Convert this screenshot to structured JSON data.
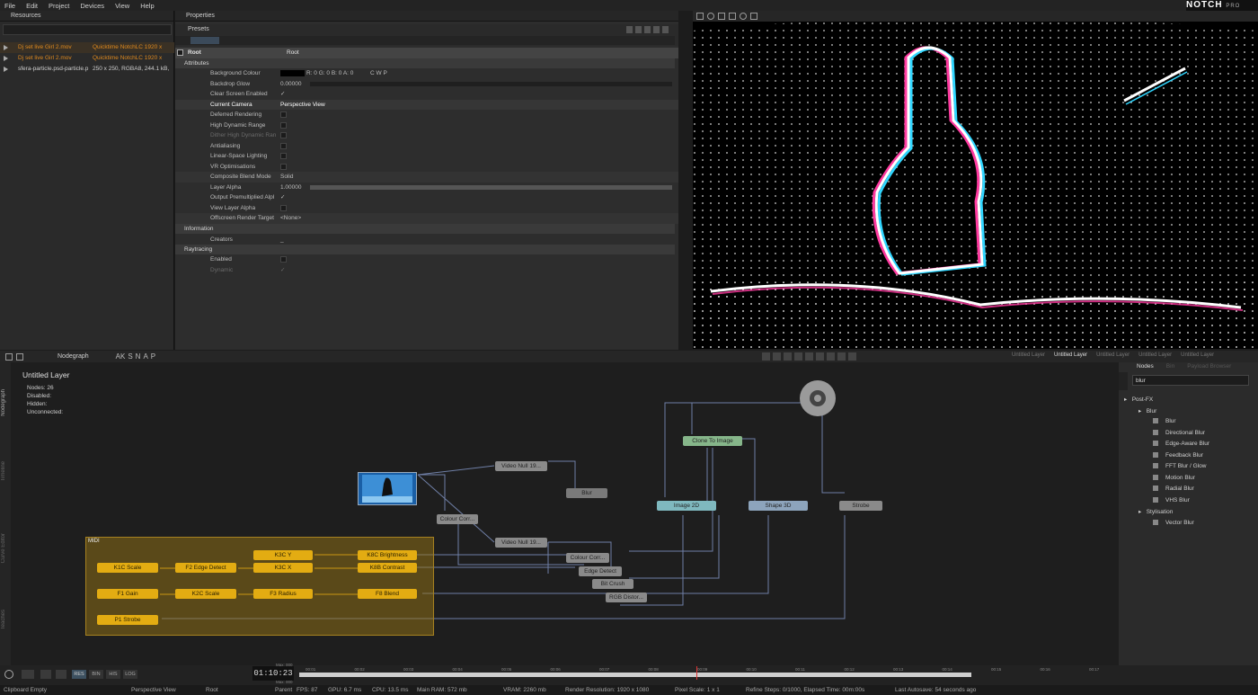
{
  "menu": [
    "File",
    "Edit",
    "Project",
    "Devices",
    "View",
    "Help"
  ],
  "brand": {
    "logo": "NOTCH",
    "edition": "PRO"
  },
  "resources": {
    "title": "Resources",
    "items": [
      {
        "name": "Dj set live Girl 2.mov",
        "format": "Quicktime NotchLC 1920 x",
        "highlight": true
      },
      {
        "name": "Dj set live Girl 2.mov",
        "format": "Quicktime NotchLC 1920 x",
        "highlight": true
      },
      {
        "name": "sfera-particle.psd-particle.p",
        "format": "250 x 250, RGBA8, 244.1 kB,",
        "highlight": false
      }
    ]
  },
  "properties": {
    "title": "Properties",
    "presets_label": "Presets",
    "root": {
      "label": "Root",
      "value": "Root"
    },
    "sections": {
      "attributes": "Attributes",
      "information": "Information",
      "raytracing": "Raytracing"
    },
    "rows": [
      {
        "label": "Background Colour",
        "value": "R: 0 G: 0 B: 0 A: 0",
        "extra": "C   W   P"
      },
      {
        "label": "Backdrop Glow",
        "value": "0.00000"
      },
      {
        "label": "Clear Screen Enabled",
        "value": "✓"
      },
      {
        "label": "Current Camera",
        "value": "Perspective View"
      },
      {
        "label": "Deferred Rendering",
        "value": ""
      },
      {
        "label": "High Dynamic Range",
        "value": ""
      },
      {
        "label": "Dither High Dynamic Ran",
        "value": "",
        "dim": true
      },
      {
        "label": "Antialiasing",
        "value": ""
      },
      {
        "label": "Linear-Space Lighting",
        "value": ""
      },
      {
        "label": "VR Optimisations",
        "value": ""
      },
      {
        "label": "Composite Blend Mode",
        "value": "Solid"
      },
      {
        "label": "Layer Alpha",
        "value": "1.00000"
      },
      {
        "label": "Output Premultiplied Alpl",
        "value": "✓"
      },
      {
        "label": "View Layer Alpha",
        "value": ""
      },
      {
        "label": "Offscreen Render Target",
        "value": "<None>"
      }
    ],
    "info_rows": [
      {
        "label": "Creators",
        "value": "_"
      }
    ],
    "ray_rows": [
      {
        "label": "Enabled",
        "value": ""
      },
      {
        "label": "Dynamic",
        "value": "✓",
        "dim": true
      }
    ]
  },
  "nodegraph": {
    "tab": "Nodegraph",
    "toolbar_text": [
      "AK",
      "S",
      "N",
      "A",
      "P"
    ],
    "layer_title": "Untitled  Layer",
    "stats": [
      {
        "label": "Nodes:",
        "value": "26"
      },
      {
        "label": "Disabled:",
        "value": ""
      },
      {
        "label": "Hidden:",
        "value": ""
      },
      {
        "label": "Unconnected:",
        "value": ""
      }
    ],
    "side_tabs": [
      "Nodegraph",
      "Timeline",
      "Curve Editor",
      "Teaches"
    ],
    "midi_label": "MIDI",
    "nodes": {
      "video_null_1": "Video  Null  19...",
      "video_null_2": "Video  Null  19...",
      "blur": "Blur",
      "colour_corr_1": "Colour  Corr...",
      "colour_corr_2": "Colour  Corr...",
      "edge_detect": "Edge  Detect",
      "bit_crush": "Bit  Crush",
      "rgb_distor": "RGB  Distor...",
      "clone_to_image": "Clone  To  Image",
      "image_2d": "Image  2D",
      "shape_3d": "Shape  3D",
      "strobe": "Strobe",
      "k1c_scale": "K1C  Scale",
      "f2_edge": "F2  Edge  Detect",
      "k3c_y": "K3C  Y",
      "k3c_x": "K3C  X",
      "k8c_brightness": "K8C  Brightness",
      "k8b_contrast": "K8B  Contrast",
      "f1_gain": "F1  Gain",
      "k2c_scale": "K2C  Scale",
      "f3_radius": "F3  Radius",
      "f8_blend": "F8  Blend",
      "p1_strobe": "P1  Strobe"
    }
  },
  "nodes_panel": {
    "tabs": [
      "Nodes",
      "Bin",
      "Payload Browser"
    ],
    "search": "blur",
    "tree": [
      {
        "label": "Post-FX",
        "level": 0,
        "type": "folder"
      },
      {
        "label": "Blur",
        "level": 1,
        "type": "folder"
      },
      {
        "label": "Blur",
        "level": 2,
        "type": "item"
      },
      {
        "label": "Directional Blur",
        "level": 2,
        "type": "item"
      },
      {
        "label": "Edge-Aware Blur",
        "level": 2,
        "type": "item"
      },
      {
        "label": "Feedback Blur",
        "level": 2,
        "type": "item"
      },
      {
        "label": "FFT Blur / Glow",
        "level": 2,
        "type": "item"
      },
      {
        "label": "Motion Blur",
        "level": 2,
        "type": "item"
      },
      {
        "label": "Radial Blur",
        "level": 2,
        "type": "item"
      },
      {
        "label": "VHS Blur",
        "level": 2,
        "type": "item"
      },
      {
        "label": "Stylisation",
        "level": 1,
        "type": "folder"
      },
      {
        "label": "Vector Blur",
        "level": 2,
        "type": "item"
      }
    ]
  },
  "layer_tabs": [
    "Untitled Layer",
    "Untitled Layer",
    "Untitled Layer",
    "Untitled Layer",
    "Untitled Layer"
  ],
  "timeline": {
    "buttons": [
      "RES",
      "BIN",
      "HIS",
      "LOG"
    ],
    "timecode": "01:10:23",
    "max": "Max: 000",
    "min": "Max: 000",
    "ticks": [
      "00:01",
      "00:02",
      "00:03",
      "00:04",
      "00:05",
      "00:06",
      "00:07",
      "00:08",
      "00:09",
      "00:10",
      "00:11",
      "00:12",
      "00:13",
      "00:14",
      "00:15",
      "00:16",
      "00:17"
    ]
  },
  "status": {
    "left": "Clipboard Empty",
    "camera": "Perspective View",
    "root": "Root",
    "parent": "Parent",
    "fps": "FPS: 87",
    "gpu": "GPU: 6.7 ms",
    "cpu": "CPU: 13.5 ms",
    "ram": "Main RAM: 572 mb",
    "vram": "VRAM: 2260 mb",
    "render_res": "Render Resolution: 1920 x 1080",
    "pixel_scale": "Pixel Scale: 1 x 1",
    "refine": "Refine Steps: 0/1000, Elapsed Time: 00m:00s",
    "autosave": "Last Autosave: 54 seconds ago"
  },
  "colors": {
    "accent": "#e3ac12",
    "highlight_text": "#e08a1e",
    "panel": "#2d2d2d"
  }
}
